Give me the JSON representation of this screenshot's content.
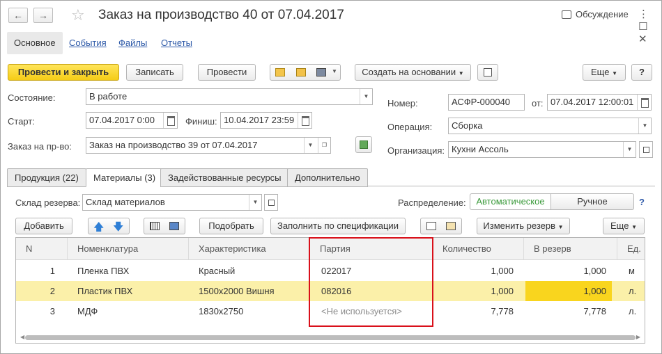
{
  "window": {
    "title": "Заказ на производство 40 от 07.04.2017",
    "back": "←",
    "forward": "→",
    "discussion": "Обсуждение",
    "controls": "⋮ ☐ ✕"
  },
  "top_tabs": [
    {
      "label": "Основное"
    },
    {
      "label": "События"
    },
    {
      "label": "Файлы"
    },
    {
      "label": "Отчеты"
    }
  ],
  "toolbar": {
    "post_close": "Провести и закрыть",
    "save": "Записать",
    "post": "Провести",
    "create_based": "Создать на основании",
    "more": "Еще",
    "help": "?"
  },
  "form": {
    "state_label": "Состояние:",
    "state_value": "В работе",
    "start_label": "Старт:",
    "start_value": "07.04.2017  0:00",
    "finish_label": "Финиш:",
    "finish_value": "10.04.2017 23:59",
    "order_label": "Заказ на пр-во:",
    "order_value": "Заказ на производство 39 от 07.04.2017",
    "number_label": "Номер:",
    "number_value": "АСФР-000040",
    "from_label": "от:",
    "from_value": "07.04.2017 12:00:01",
    "operation_label": "Операция:",
    "operation_value": "Сборка",
    "org_label": "Организация:",
    "org_value": "Кухни Ассоль"
  },
  "sub_tabs": [
    {
      "label": "Продукция (22)"
    },
    {
      "label": "Материалы (3)"
    },
    {
      "label": "Задействованные ресурсы"
    },
    {
      "label": "Дополнительно"
    }
  ],
  "materials": {
    "warehouse_label": "Склад резерва:",
    "warehouse_value": "Склад материалов",
    "distribution_label": "Распределение:",
    "dist_auto": "Автоматическое",
    "dist_manual": "Ручное",
    "help": "?",
    "add": "Добавить",
    "pick": "Подобрать",
    "fill_spec": "Заполнить по спецификации",
    "change_reserve": "Изменить резерв",
    "more": "Еще"
  },
  "table": {
    "columns": [
      "N",
      "Номенклатура",
      "Характеристика",
      "Партия",
      "Количество",
      "В резерв",
      "Ед."
    ],
    "rows": [
      {
        "n": "1",
        "item": "Пленка ПВХ",
        "char": "Красный",
        "batch": "022017",
        "qty": "1,000",
        "reserve": "1,000",
        "unit": "м"
      },
      {
        "n": "2",
        "item": "Пластик ПВХ",
        "char": "1500x2000 Вишня",
        "batch": "082016",
        "qty": "1,000",
        "reserve": "1,000",
        "unit": "л."
      },
      {
        "n": "3",
        "item": "МДФ",
        "char": "1830x2750",
        "batch": "<Не используется>",
        "qty": "7,778",
        "reserve": "7,778",
        "unit": "л."
      }
    ]
  },
  "colors": {
    "accent_yellow": "#f5cc16",
    "selected_row": "#fbf0a9",
    "highlight_box": "#d9101a",
    "link_blue": "#2d59a8"
  }
}
